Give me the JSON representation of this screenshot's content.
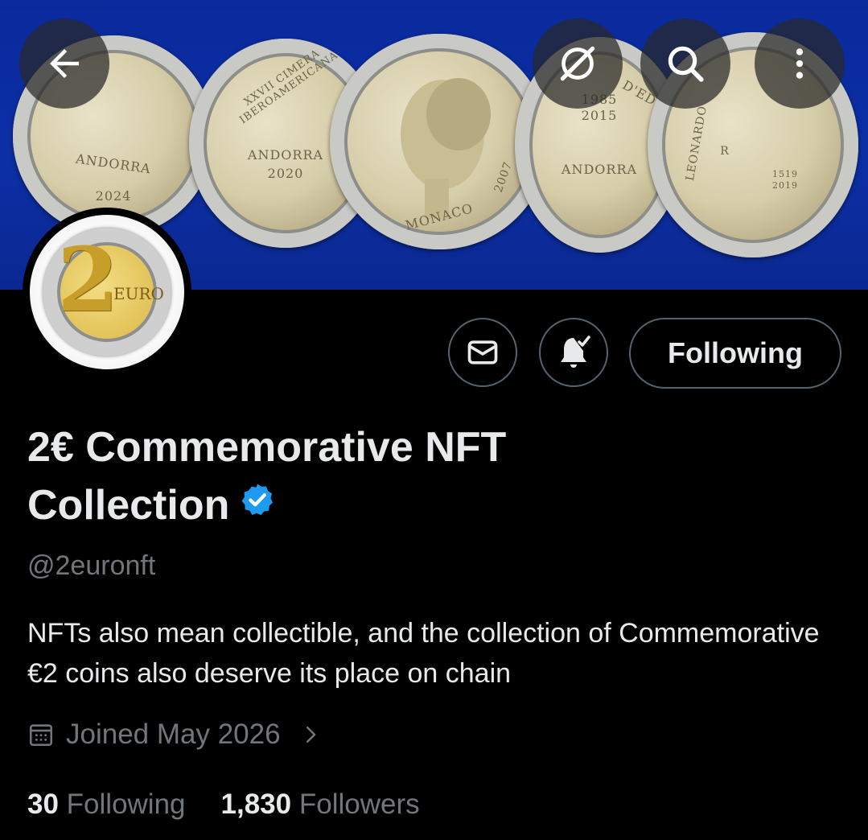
{
  "header": {
    "back_icon": "arrow-left-icon",
    "explore_icon": "grok-explore-icon",
    "search_icon": "search-icon",
    "more_icon": "more-vertical-icon"
  },
  "banner": {
    "coins": [
      {
        "texts": [
          "ANDORRA",
          "2024"
        ]
      },
      {
        "texts": [
          "XXVII CIMERA IBEROAMERICANA",
          "ANDORRA",
          "2020"
        ]
      },
      {
        "texts": [
          "MONACO",
          "2007"
        ]
      },
      {
        "texts": [
          "1985",
          "2015",
          "D'ED",
          "ANDORRA"
        ]
      },
      {
        "texts": [
          "LEONARDO",
          "R",
          "1519",
          "2019"
        ]
      }
    ],
    "background_color": "#0c2fa6"
  },
  "avatar": {
    "texts": [
      "2",
      "EURO"
    ]
  },
  "actions": {
    "message_icon": "envelope-icon",
    "notify_icon": "bell-check-icon",
    "follow_label": "Following"
  },
  "profile": {
    "name_line1": "2€ Commemorative NFT",
    "name_line2": "Collection",
    "verified_color": "#1d9bf0",
    "handle": "@2euronft",
    "bio": "NFTs also mean collectible, and the collection of Commemorative €2 coins also deserve its place on chain",
    "joined": "Joined May 2026"
  },
  "stats": {
    "following_count": "30",
    "following_label": "Following",
    "followers_count": "1,830",
    "followers_label": "Followers"
  }
}
